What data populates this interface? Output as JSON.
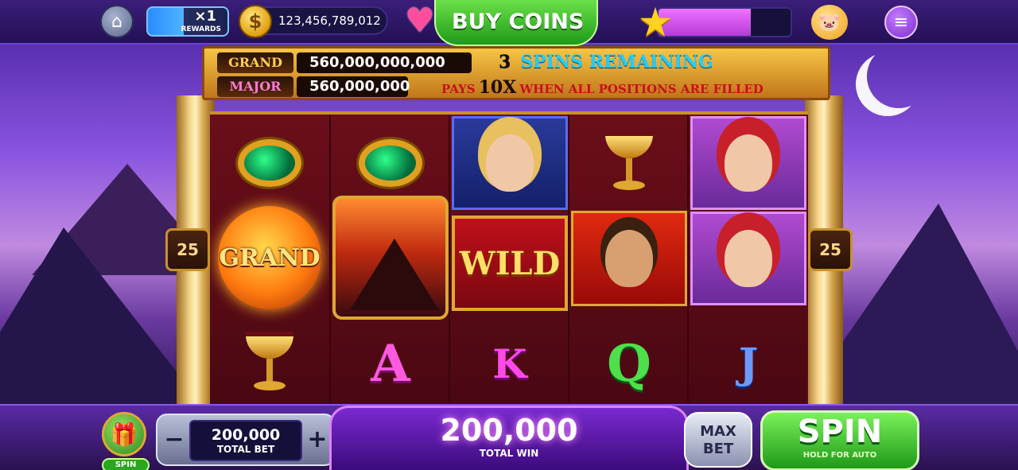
{
  "topbar": {
    "rewards_mult": "×1",
    "rewards_label": "REWARDS",
    "coins": "123,456,789,012",
    "buy_coins_label": "BUY COINS",
    "xp_progress": 0.7
  },
  "jackpot": {
    "grand_label": "GRAND",
    "grand_value": "560,000,000,000",
    "major_label": "MAJOR",
    "major_value": "560,000,000",
    "spins_count": "3",
    "spins_text": "SPINS REMAINING",
    "pays_prefix": "PAYS",
    "pays_mult": "10X",
    "pays_suffix": "WHEN ALL POSITIONS ARE FILLED"
  },
  "reels": {
    "lines_left": "25",
    "lines_right": "25",
    "grand_symbol": "GRAND",
    "wild_symbol": "WILD",
    "letters": {
      "a": "A",
      "k": "K",
      "q": "Q",
      "j": "J"
    }
  },
  "bottombar": {
    "gift_label": "SPIN",
    "bet_minus": "−",
    "bet_plus": "+",
    "total_bet": "200,000",
    "total_bet_label": "TOTAL BET",
    "total_win": "200,000",
    "total_win_label": "TOTAL WIN",
    "max_bet_label_1": "MAX",
    "max_bet_label_2": "BET",
    "spin_label": "SPIN",
    "spin_sub": "HOLD FOR AUTO"
  }
}
